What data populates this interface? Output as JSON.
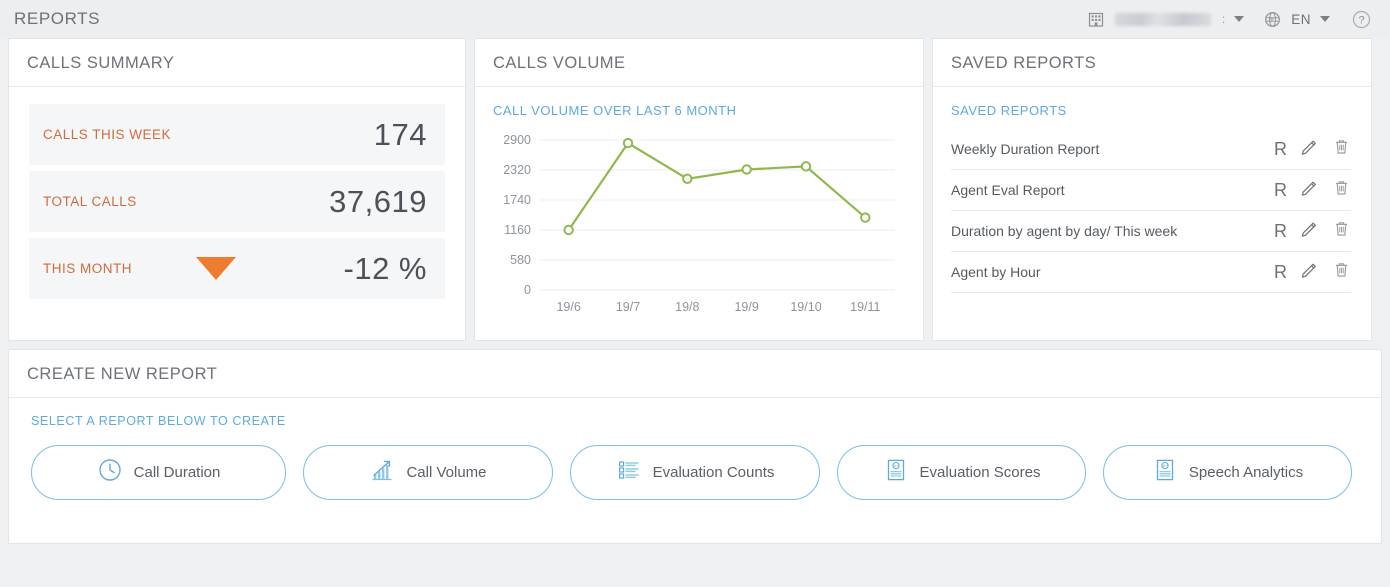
{
  "header": {
    "title": "REPORTS",
    "building_icon": "building-icon",
    "account_redacted": true,
    "account_tail": ":",
    "account_caret": "chevron-down-icon",
    "globe_icon": "globe-icon",
    "language": "EN",
    "language_caret": "chevron-down-icon",
    "help_icon": "help-icon"
  },
  "calls_summary": {
    "title": "CALLS SUMMARY",
    "rows": [
      {
        "label": "CALLS THIS WEEK",
        "value": "174",
        "trend": null
      },
      {
        "label": "TOTAL CALLS",
        "value": "37,619",
        "trend": null
      },
      {
        "label": "THIS MONTH",
        "value": "-12 %",
        "trend": "down"
      }
    ]
  },
  "calls_volume": {
    "title": "CALLS VOLUME"
  },
  "chart_data": {
    "type": "line",
    "title": "CALL VOLUME OVER LAST 6 MONTH",
    "xlabel": "",
    "ylabel": "",
    "categories": [
      "19/6",
      "19/7",
      "19/8",
      "19/9",
      "19/10",
      "19/11"
    ],
    "values": [
      1160,
      2840,
      2150,
      2330,
      2390,
      1400
    ],
    "yticks": [
      2900,
      2320,
      1740,
      1160,
      580,
      0
    ],
    "ylim": [
      0,
      2900
    ],
    "grid": true,
    "legend": "none",
    "line_color": "#8fb94f",
    "marker": "open-circle"
  },
  "saved_reports": {
    "title": "SAVED REPORTS",
    "link": "SAVED REPORTS",
    "action_labels": {
      "run": "R",
      "edit": "edit-icon",
      "delete": "delete-icon"
    },
    "items": [
      {
        "name": "Weekly Duration Report"
      },
      {
        "name": "Agent Eval Report"
      },
      {
        "name": "Duration by agent by day/ This week"
      },
      {
        "name": "Agent by Hour"
      }
    ]
  },
  "create_new_report": {
    "title": "CREATE NEW REPORT",
    "hint": "SELECT A REPORT BELOW TO CREATE",
    "chips": [
      {
        "label": "Call Duration",
        "icon": "clock-icon"
      },
      {
        "label": "Call Volume",
        "icon": "bar-chart-arrow-icon"
      },
      {
        "label": "Evaluation Counts",
        "icon": "checklist-icon"
      },
      {
        "label": "Evaluation Scores",
        "icon": "graded-document-icon"
      },
      {
        "label": "Speech Analytics",
        "icon": "graded-document-icon"
      }
    ]
  },
  "colors": {
    "accent_blue": "#5eaadd",
    "accent_orange": "#cf6c3c",
    "trend_orange": "#ee7b2e",
    "chart_green": "#8fb94f",
    "text_gray": "#6d7278",
    "background": "#eef0f2"
  }
}
